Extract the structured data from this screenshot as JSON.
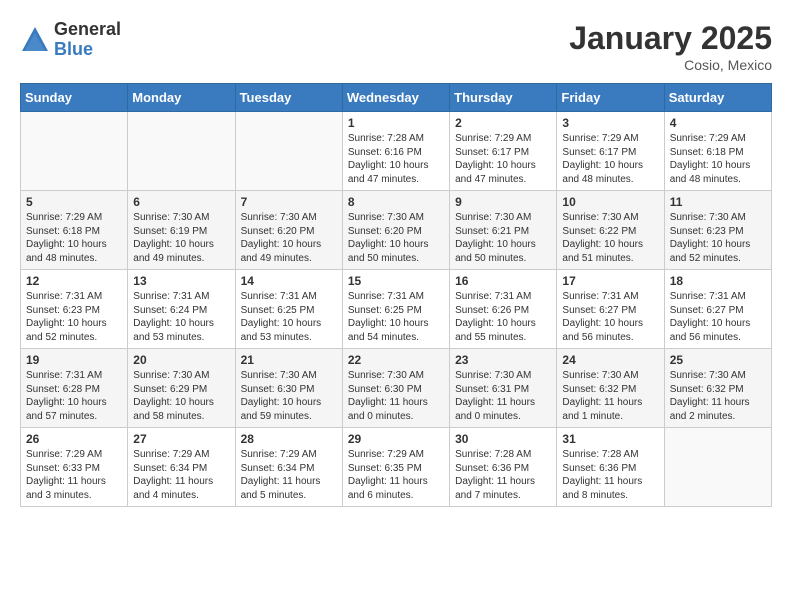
{
  "logo": {
    "general": "General",
    "blue": "Blue"
  },
  "title": "January 2025",
  "location": "Cosio, Mexico",
  "days_header": [
    "Sunday",
    "Monday",
    "Tuesday",
    "Wednesday",
    "Thursday",
    "Friday",
    "Saturday"
  ],
  "weeks": [
    [
      {
        "day": "",
        "info": ""
      },
      {
        "day": "",
        "info": ""
      },
      {
        "day": "",
        "info": ""
      },
      {
        "day": "1",
        "info": "Sunrise: 7:28 AM\nSunset: 6:16 PM\nDaylight: 10 hours\nand 47 minutes."
      },
      {
        "day": "2",
        "info": "Sunrise: 7:29 AM\nSunset: 6:17 PM\nDaylight: 10 hours\nand 47 minutes."
      },
      {
        "day": "3",
        "info": "Sunrise: 7:29 AM\nSunset: 6:17 PM\nDaylight: 10 hours\nand 48 minutes."
      },
      {
        "day": "4",
        "info": "Sunrise: 7:29 AM\nSunset: 6:18 PM\nDaylight: 10 hours\nand 48 minutes."
      }
    ],
    [
      {
        "day": "5",
        "info": "Sunrise: 7:29 AM\nSunset: 6:18 PM\nDaylight: 10 hours\nand 48 minutes."
      },
      {
        "day": "6",
        "info": "Sunrise: 7:30 AM\nSunset: 6:19 PM\nDaylight: 10 hours\nand 49 minutes."
      },
      {
        "day": "7",
        "info": "Sunrise: 7:30 AM\nSunset: 6:20 PM\nDaylight: 10 hours\nand 49 minutes."
      },
      {
        "day": "8",
        "info": "Sunrise: 7:30 AM\nSunset: 6:20 PM\nDaylight: 10 hours\nand 50 minutes."
      },
      {
        "day": "9",
        "info": "Sunrise: 7:30 AM\nSunset: 6:21 PM\nDaylight: 10 hours\nand 50 minutes."
      },
      {
        "day": "10",
        "info": "Sunrise: 7:30 AM\nSunset: 6:22 PM\nDaylight: 10 hours\nand 51 minutes."
      },
      {
        "day": "11",
        "info": "Sunrise: 7:30 AM\nSunset: 6:23 PM\nDaylight: 10 hours\nand 52 minutes."
      }
    ],
    [
      {
        "day": "12",
        "info": "Sunrise: 7:31 AM\nSunset: 6:23 PM\nDaylight: 10 hours\nand 52 minutes."
      },
      {
        "day": "13",
        "info": "Sunrise: 7:31 AM\nSunset: 6:24 PM\nDaylight: 10 hours\nand 53 minutes."
      },
      {
        "day": "14",
        "info": "Sunrise: 7:31 AM\nSunset: 6:25 PM\nDaylight: 10 hours\nand 53 minutes."
      },
      {
        "day": "15",
        "info": "Sunrise: 7:31 AM\nSunset: 6:25 PM\nDaylight: 10 hours\nand 54 minutes."
      },
      {
        "day": "16",
        "info": "Sunrise: 7:31 AM\nSunset: 6:26 PM\nDaylight: 10 hours\nand 55 minutes."
      },
      {
        "day": "17",
        "info": "Sunrise: 7:31 AM\nSunset: 6:27 PM\nDaylight: 10 hours\nand 56 minutes."
      },
      {
        "day": "18",
        "info": "Sunrise: 7:31 AM\nSunset: 6:27 PM\nDaylight: 10 hours\nand 56 minutes."
      }
    ],
    [
      {
        "day": "19",
        "info": "Sunrise: 7:31 AM\nSunset: 6:28 PM\nDaylight: 10 hours\nand 57 minutes."
      },
      {
        "day": "20",
        "info": "Sunrise: 7:30 AM\nSunset: 6:29 PM\nDaylight: 10 hours\nand 58 minutes."
      },
      {
        "day": "21",
        "info": "Sunrise: 7:30 AM\nSunset: 6:30 PM\nDaylight: 10 hours\nand 59 minutes."
      },
      {
        "day": "22",
        "info": "Sunrise: 7:30 AM\nSunset: 6:30 PM\nDaylight: 11 hours\nand 0 minutes."
      },
      {
        "day": "23",
        "info": "Sunrise: 7:30 AM\nSunset: 6:31 PM\nDaylight: 11 hours\nand 0 minutes."
      },
      {
        "day": "24",
        "info": "Sunrise: 7:30 AM\nSunset: 6:32 PM\nDaylight: 11 hours\nand 1 minute."
      },
      {
        "day": "25",
        "info": "Sunrise: 7:30 AM\nSunset: 6:32 PM\nDaylight: 11 hours\nand 2 minutes."
      }
    ],
    [
      {
        "day": "26",
        "info": "Sunrise: 7:29 AM\nSunset: 6:33 PM\nDaylight: 11 hours\nand 3 minutes."
      },
      {
        "day": "27",
        "info": "Sunrise: 7:29 AM\nSunset: 6:34 PM\nDaylight: 11 hours\nand 4 minutes."
      },
      {
        "day": "28",
        "info": "Sunrise: 7:29 AM\nSunset: 6:34 PM\nDaylight: 11 hours\nand 5 minutes."
      },
      {
        "day": "29",
        "info": "Sunrise: 7:29 AM\nSunset: 6:35 PM\nDaylight: 11 hours\nand 6 minutes."
      },
      {
        "day": "30",
        "info": "Sunrise: 7:28 AM\nSunset: 6:36 PM\nDaylight: 11 hours\nand 7 minutes."
      },
      {
        "day": "31",
        "info": "Sunrise: 7:28 AM\nSunset: 6:36 PM\nDaylight: 11 hours\nand 8 minutes."
      },
      {
        "day": "",
        "info": ""
      }
    ]
  ]
}
